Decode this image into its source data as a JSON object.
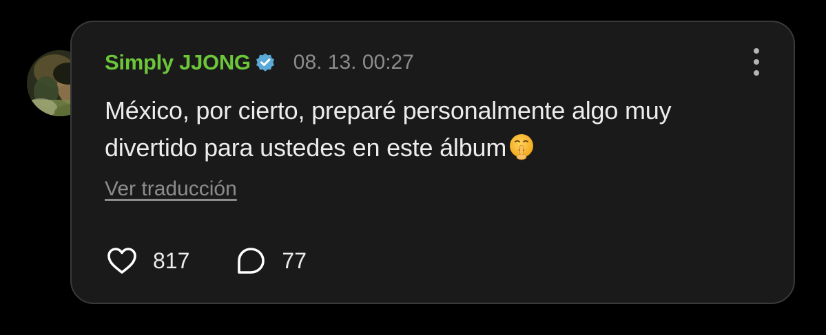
{
  "post": {
    "author": "Simply JJONG",
    "verified": true,
    "timestamp": "08. 13. 00:27",
    "text": "México, por cierto, preparé personalmente algo muy divertido para ustedes en este álbum",
    "emoji": "shushing-face-emoji",
    "translate_label": "Ver traducción",
    "likes": "817",
    "comments": "77"
  },
  "colors": {
    "background": "#000000",
    "card": "#1a1a1a",
    "author": "#6cc63a",
    "verified_badge": "#5aa9d6",
    "muted_text": "#8c8c8c",
    "body_text": "#ececec"
  },
  "icons": {
    "verified": "verified-badge-icon",
    "more": "more-vertical-icon",
    "like": "heart-icon",
    "comment": "speech-bubble-icon"
  }
}
